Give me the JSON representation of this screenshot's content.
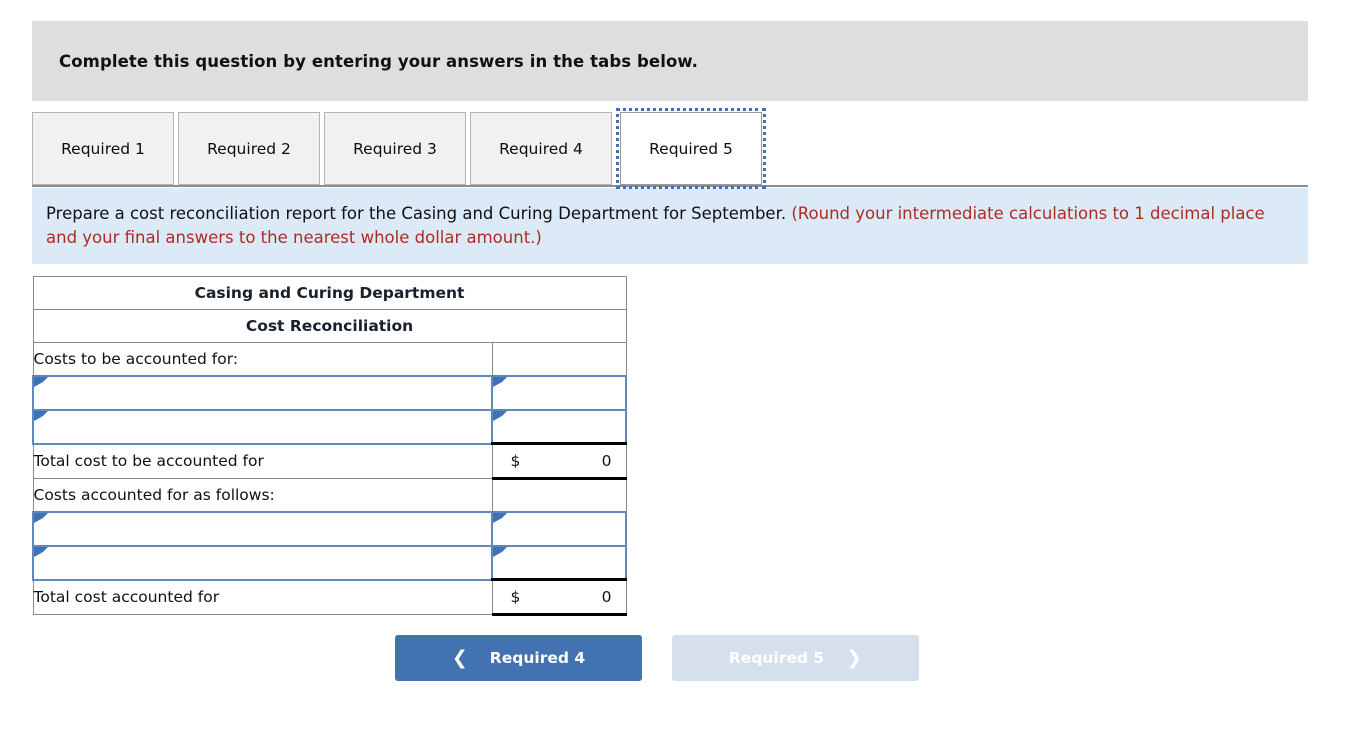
{
  "banner": {
    "text": "Complete this question by entering your answers in the tabs below."
  },
  "tabs": [
    {
      "label": "Required 1",
      "active": false
    },
    {
      "label": "Required 2",
      "active": false
    },
    {
      "label": "Required 3",
      "active": false
    },
    {
      "label": "Required 4",
      "active": false
    },
    {
      "label": "Required 5",
      "active": true
    }
  ],
  "instructions": {
    "main": "Prepare a cost reconciliation report for the Casing and Curing Department for September.",
    "note": "(Round your intermediate calculations to 1 decimal place and your final answers to the nearest whole dollar amount.)"
  },
  "sheet": {
    "title": "Casing and Curing Department",
    "subtitle": "Cost Reconciliation",
    "rows": [
      {
        "type": "section",
        "label": "Costs to be accounted for:",
        "value": ""
      },
      {
        "type": "dropdown",
        "label": "",
        "value": ""
      },
      {
        "type": "dropdown",
        "label": "",
        "value": ""
      },
      {
        "type": "total",
        "label": "Total cost to be accounted for",
        "currency": "$",
        "value": "0"
      },
      {
        "type": "section",
        "label": "Costs accounted for as follows:",
        "value": ""
      },
      {
        "type": "dropdown",
        "label": "",
        "value": ""
      },
      {
        "type": "dropdown",
        "label": "",
        "value": ""
      },
      {
        "type": "total",
        "label": "Total cost accounted for",
        "currency": "$",
        "value": "0"
      }
    ]
  },
  "nav": {
    "prev_label": "Required 4",
    "prev_icon": "chevron-left-icon",
    "next_label": "Required 5",
    "next_icon": "chevron-right-icon"
  },
  "colors": {
    "banner_bg": "#dedede",
    "instruction_bg": "#dce9f7",
    "note_text": "#b02b22",
    "header_blue": "#7fa9dc",
    "accent_blue": "#4272b0",
    "disabled_blue": "#d6e0ec",
    "dropdown_border": "#5f88bf"
  }
}
